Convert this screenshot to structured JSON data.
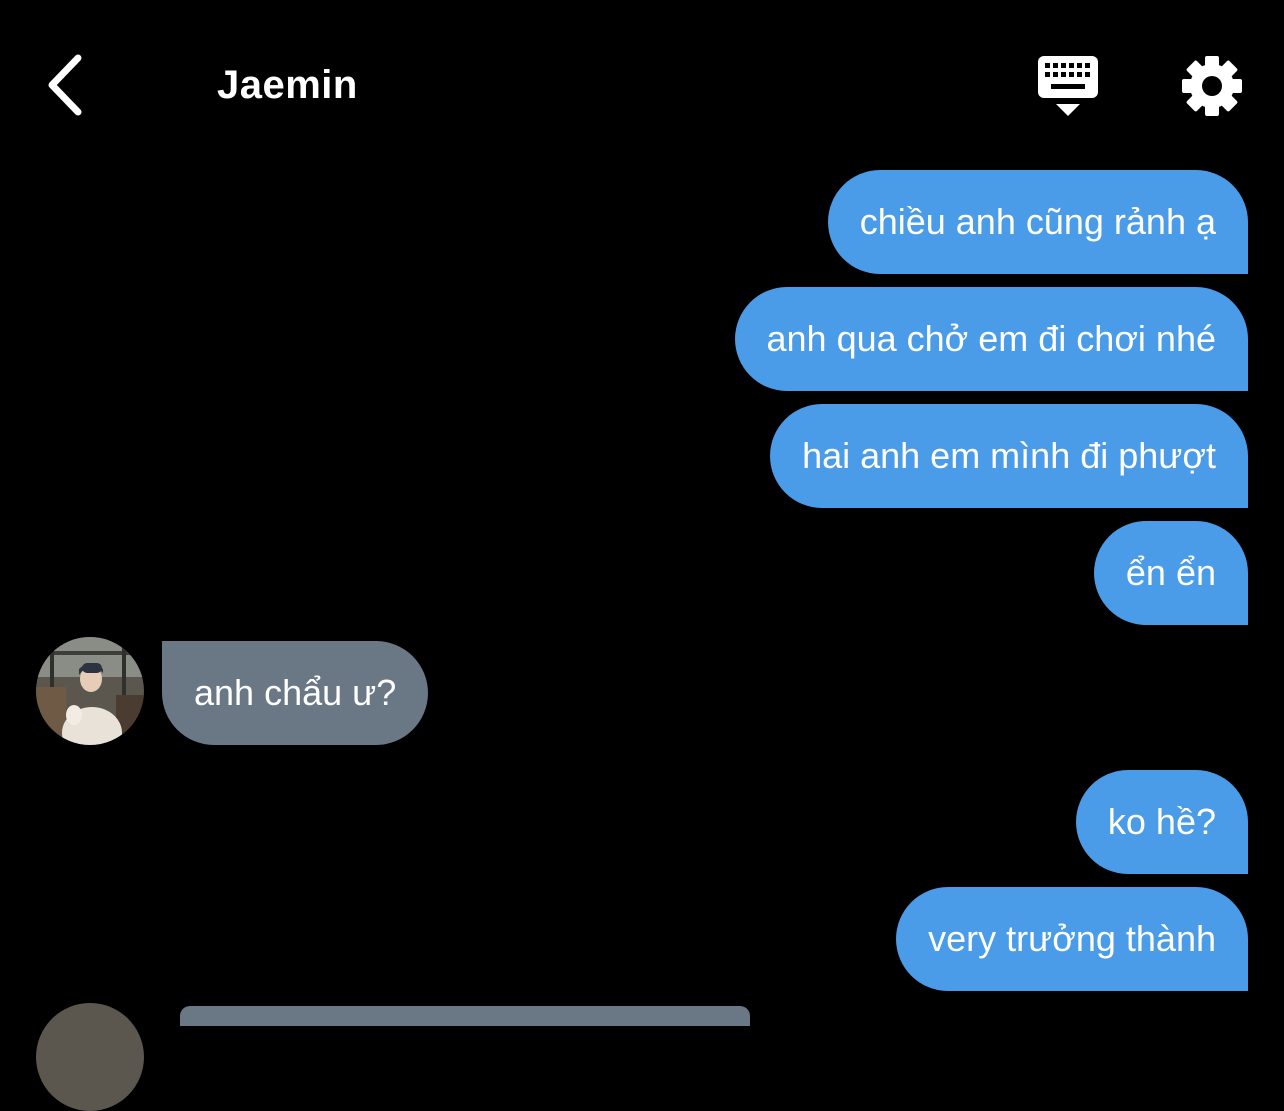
{
  "header": {
    "title": "Jaemin",
    "back_icon": "chevron-left-icon",
    "keyboard_icon": "keyboard-dismiss-icon",
    "settings_icon": "gear-icon"
  },
  "colors": {
    "background": "#000000",
    "sent_bubble": "#4A9BE8",
    "received_bubble": "#6A7784",
    "text": "#FFFFFF"
  },
  "messages": [
    {
      "sender": "me",
      "text": "chiều anh cũng rảnh ạ"
    },
    {
      "sender": "me",
      "text": "anh qua chở em đi chơi nhé"
    },
    {
      "sender": "me",
      "text": "hai anh em mình đi phượt"
    },
    {
      "sender": "me",
      "text": "ển ển"
    },
    {
      "sender": "Jaemin",
      "text": "anh chẩu ư?"
    },
    {
      "sender": "me",
      "text": "ko hề?"
    },
    {
      "sender": "me",
      "text": "very trưởng thành"
    }
  ]
}
